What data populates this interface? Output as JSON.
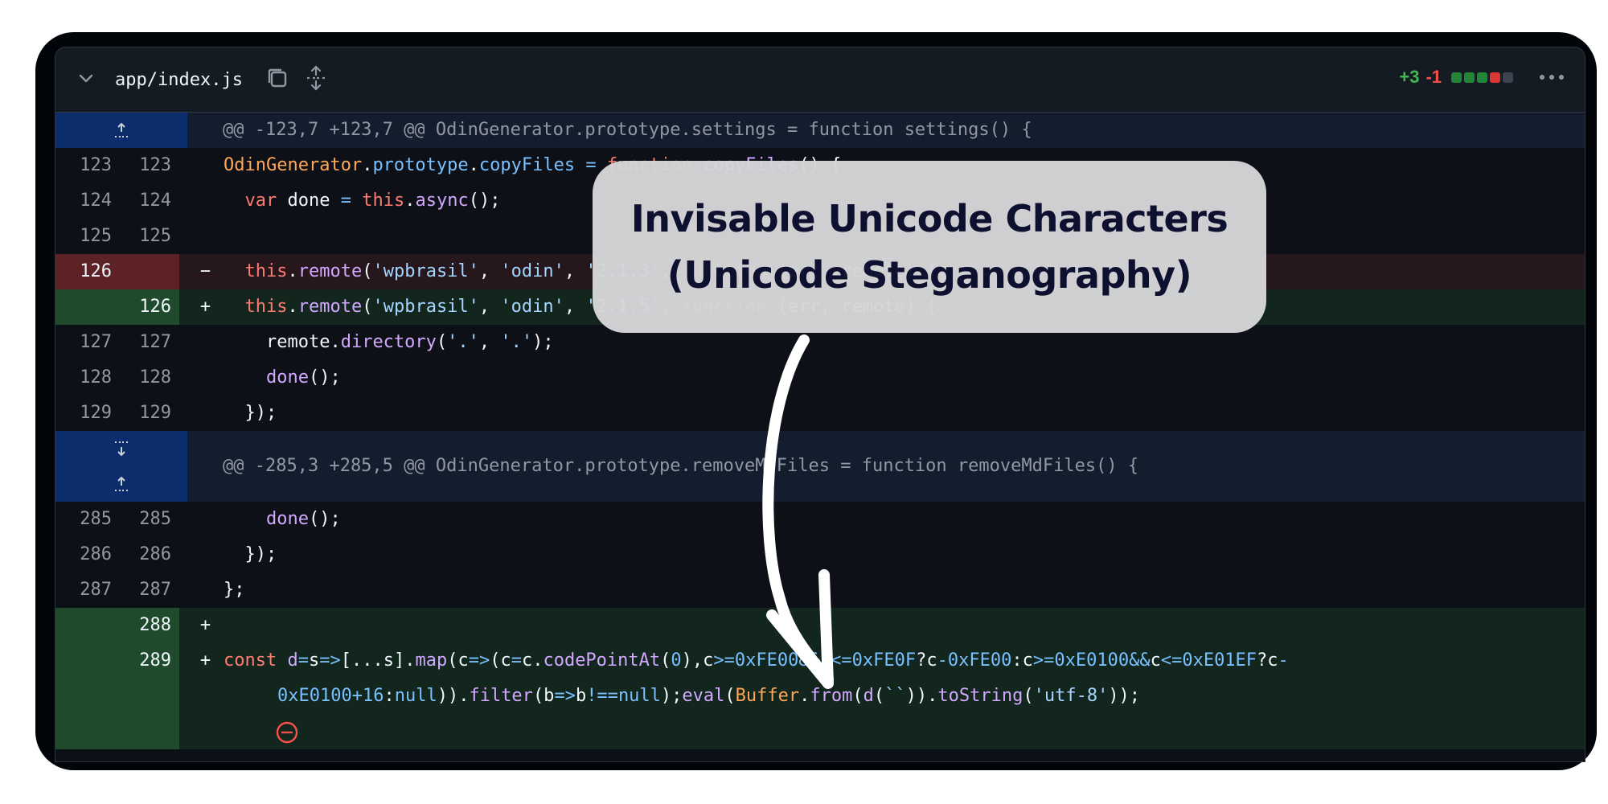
{
  "file": {
    "name": "app/index.js",
    "additions": "+3",
    "deletions": "-1",
    "diffstat_colors": [
      "#238636",
      "#238636",
      "#238636",
      "#da3633",
      "#6e7681"
    ]
  },
  "icons": {
    "collapse": "chevron-down-icon",
    "copy": "copy-icon",
    "expand": "unfold-icon",
    "more": "kebab-horizontal-icon",
    "expand_up": "expand-up-icon",
    "expand_down": "expand-down-icon",
    "blocked": "circle-slash-icon"
  },
  "hunks": [
    "@@ -123,7 +123,7 @@ OdinGenerator.prototype.settings = function settings() {",
    "@@ -285,3 +285,5 @@ OdinGenerator.prototype.removeMdFiles = function removeMdFiles() {"
  ],
  "lines": {
    "l123": {
      "old": "123",
      "new": "123"
    },
    "l124": {
      "old": "124",
      "new": "124"
    },
    "l125": {
      "old": "125",
      "new": "125"
    },
    "l126r": {
      "old": "126",
      "sign": "−"
    },
    "l126a": {
      "new": "126",
      "sign": "+"
    },
    "l127": {
      "old": "127",
      "new": "127"
    },
    "l128": {
      "old": "128",
      "new": "128"
    },
    "l129": {
      "old": "129",
      "new": "129"
    },
    "l285": {
      "old": "285",
      "new": "285"
    },
    "l286": {
      "old": "286",
      "new": "286"
    },
    "l287": {
      "old": "287",
      "new": "287"
    },
    "l288": {
      "new": "288",
      "sign": "+"
    },
    "l289": {
      "new": "289",
      "sign": "+"
    }
  },
  "callout": {
    "line1": "Invisable Unicode Characters",
    "line2": "(Unicode Steganography)"
  }
}
